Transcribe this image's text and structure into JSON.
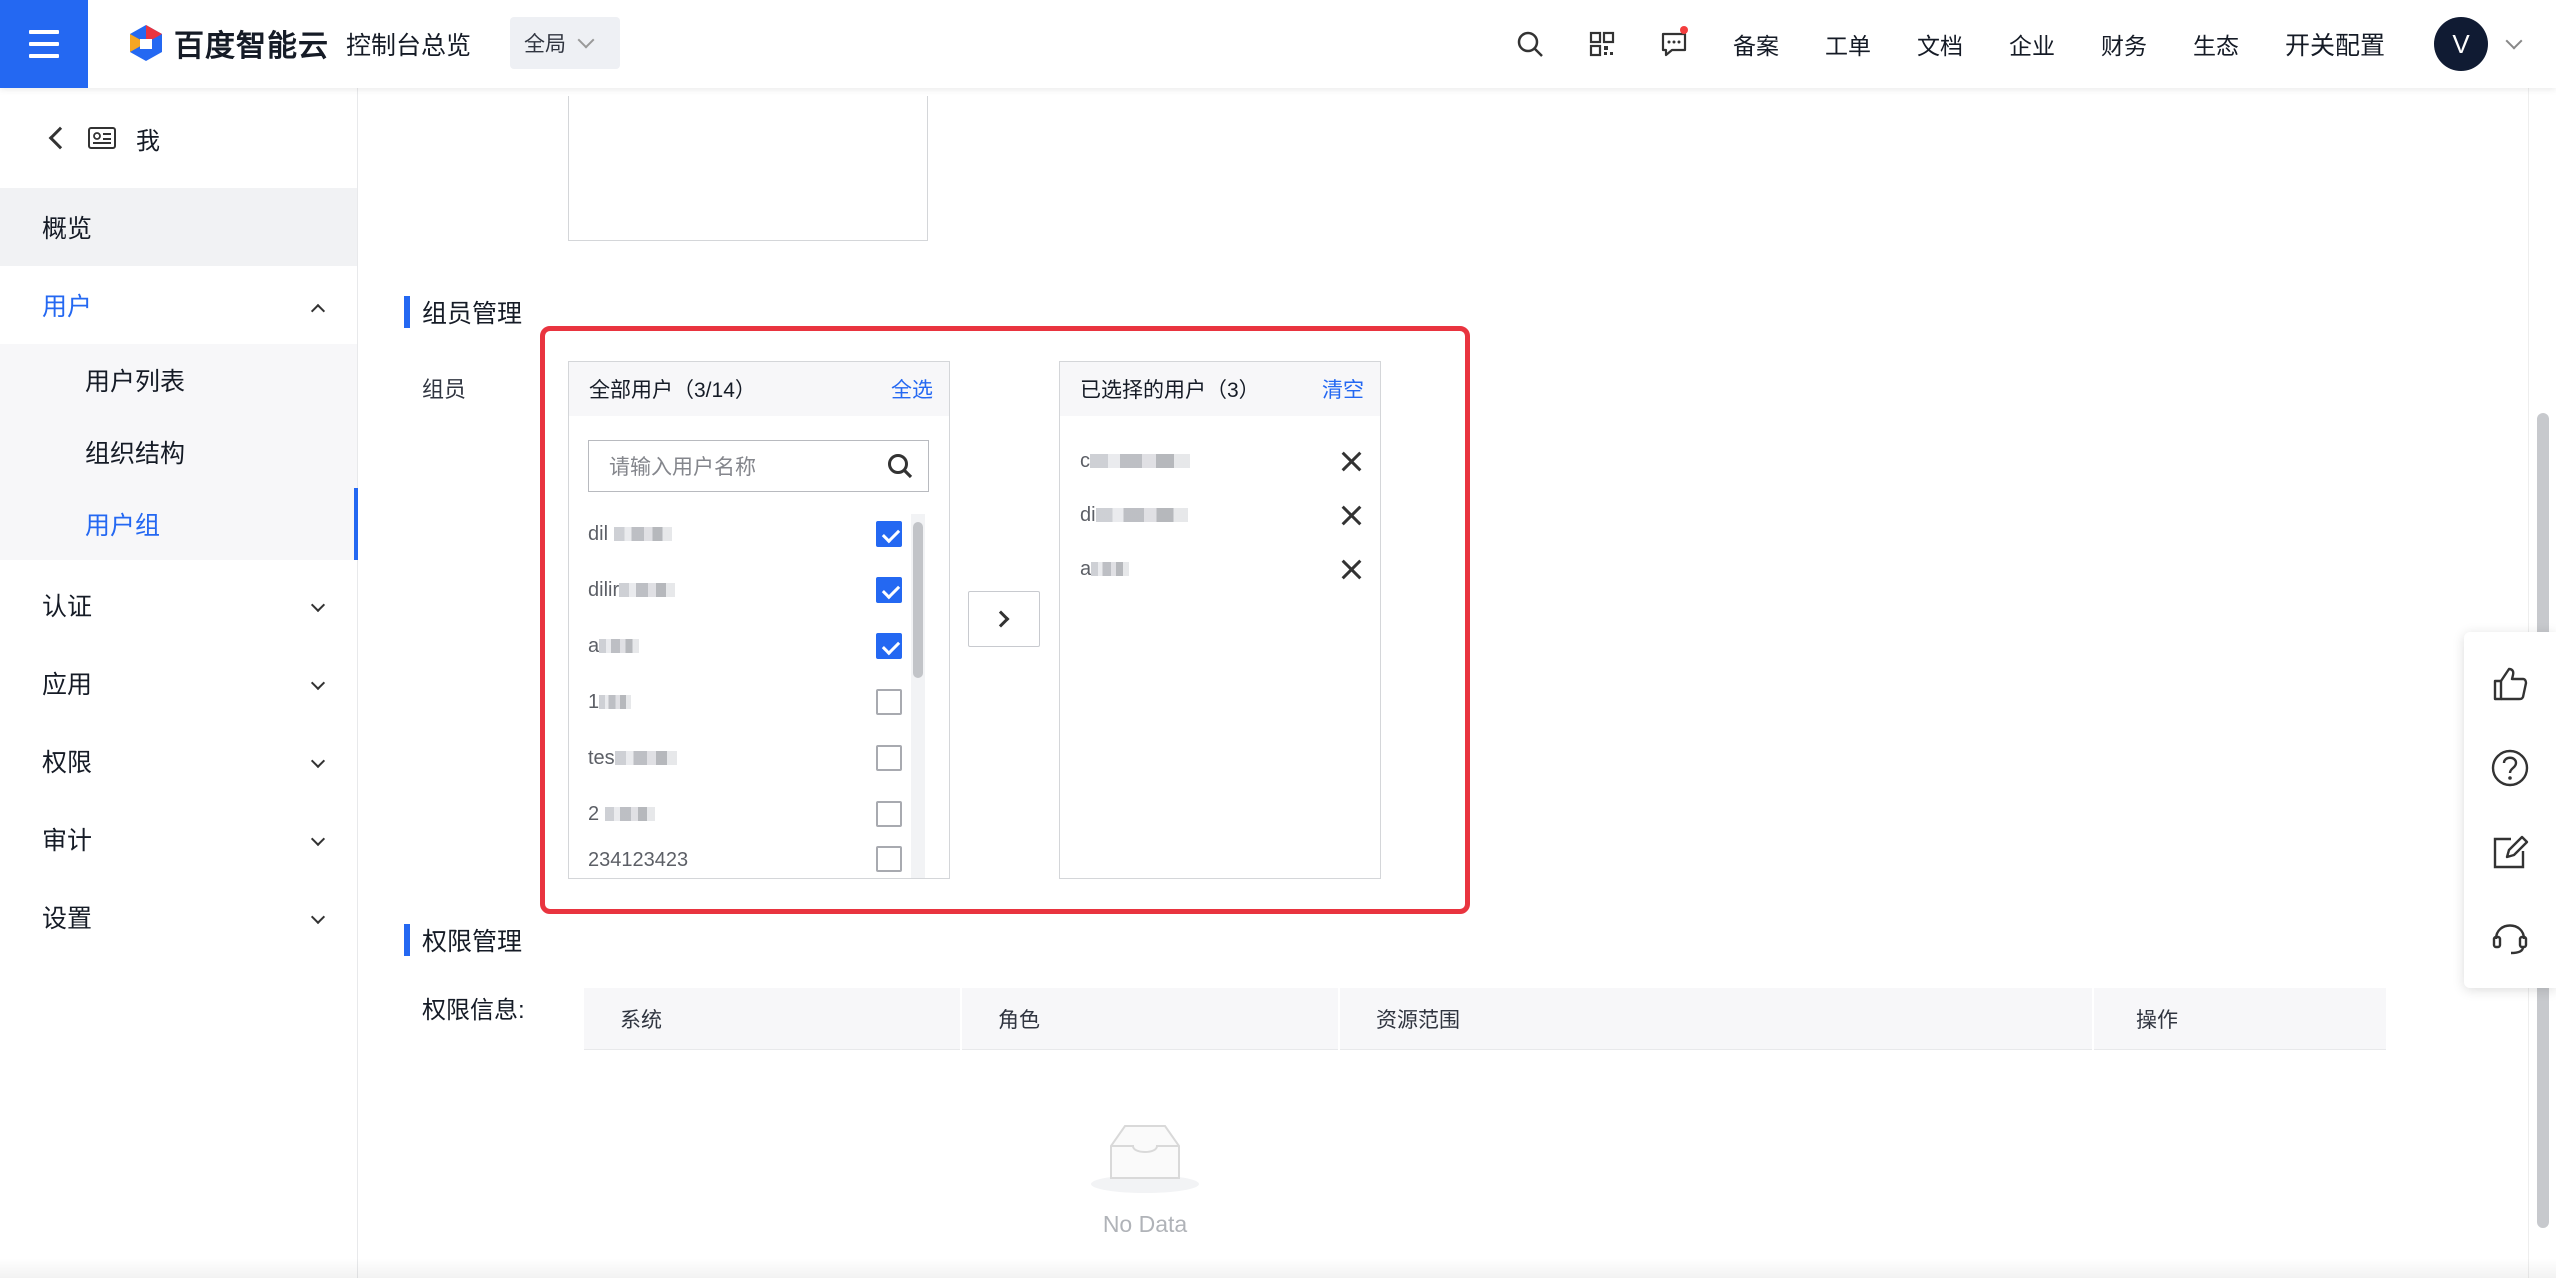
{
  "header": {
    "brand": "百度智能云",
    "console_title": "控制台总览",
    "region": "全局",
    "links": [
      "备案",
      "工单",
      "文档",
      "企业",
      "财务",
      "生态"
    ],
    "switch_config": "开关配置",
    "avatar_letter": "V",
    "icons": [
      "search-icon",
      "qrcode-icon",
      "message-icon"
    ]
  },
  "sidebar": {
    "back_label": "我",
    "items": [
      {
        "label": "概览"
      },
      {
        "label": "用户",
        "expanded": true
      },
      {
        "label": "认证"
      },
      {
        "label": "应用"
      },
      {
        "label": "权限"
      },
      {
        "label": "审计"
      },
      {
        "label": "设置"
      }
    ],
    "sub_items": [
      "用户列表",
      "组织结构",
      "用户组"
    ],
    "active_sub": "用户组"
  },
  "member_section": {
    "title": "组员管理",
    "field_label": "组员",
    "all_users": {
      "title": "全部用户（3/14）",
      "select_all": "全选",
      "search_placeholder": "请输入用户名称",
      "rows": [
        {
          "prefix": "dil",
          "checked": true
        },
        {
          "prefix": "dilir",
          "checked": true
        },
        {
          "prefix": "a",
          "checked": true
        },
        {
          "prefix": "1",
          "checked": false
        },
        {
          "prefix": "tes",
          "checked": false
        },
        {
          "prefix": "2",
          "checked": false
        },
        {
          "prefix": "234123423",
          "checked": false
        }
      ]
    },
    "selected_users": {
      "title": "已选择的用户（3）",
      "clear": "清空",
      "rows": [
        {
          "prefix": "c"
        },
        {
          "prefix": "di"
        },
        {
          "prefix": "a"
        }
      ]
    }
  },
  "permission_section": {
    "title": "权限管理",
    "field_label": "权限信息:",
    "columns": [
      "系统",
      "角色",
      "资源范围",
      "操作"
    ],
    "empty_text": "No Data"
  },
  "float_tools": [
    "thumbs-up-icon",
    "help-icon",
    "edit-icon",
    "headset-icon"
  ],
  "colors": {
    "accent": "#2468f2",
    "highlight_frame": "#e9343f"
  }
}
